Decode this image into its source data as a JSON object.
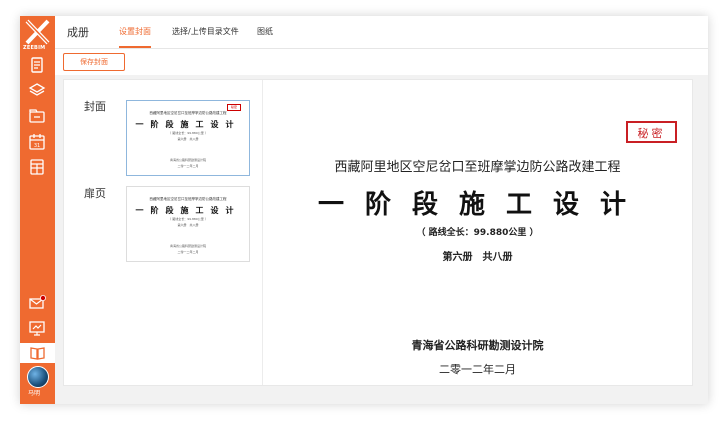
{
  "app": {
    "logo_text": "ZEEBIM",
    "user_name": "马明"
  },
  "header": {
    "title": "成册",
    "tabs": [
      {
        "label": "设置封面",
        "active": true
      },
      {
        "label": "选择/上传目录文件",
        "active": false
      },
      {
        "label": "图纸",
        "active": false
      }
    ]
  },
  "toolbar": {
    "save_label": "保存封面"
  },
  "thumbs": [
    {
      "label": "封面",
      "selected": true
    },
    {
      "label": "扉页",
      "selected": false
    }
  ],
  "cover": {
    "secret": "秘密",
    "project": "西藏阿里地区空尼岔口至班摩掌边防公路改建工程",
    "main": "一阶段施工设计",
    "route_length": "（ 路线全长：99.880公里 ）",
    "volume": "第六册　共八册",
    "organization": "青海省公路科研勘测设计院",
    "date": "二零一二年二月"
  },
  "colors": {
    "accent": "#ef6a30",
    "secret_red": "#c91f24"
  },
  "sidebar_icons": [
    "logo-icon",
    "document-icon",
    "layers-icon",
    "folder-icon",
    "calendar-icon",
    "table-icon",
    "mail-icon",
    "presentation-icon",
    "book-icon"
  ]
}
